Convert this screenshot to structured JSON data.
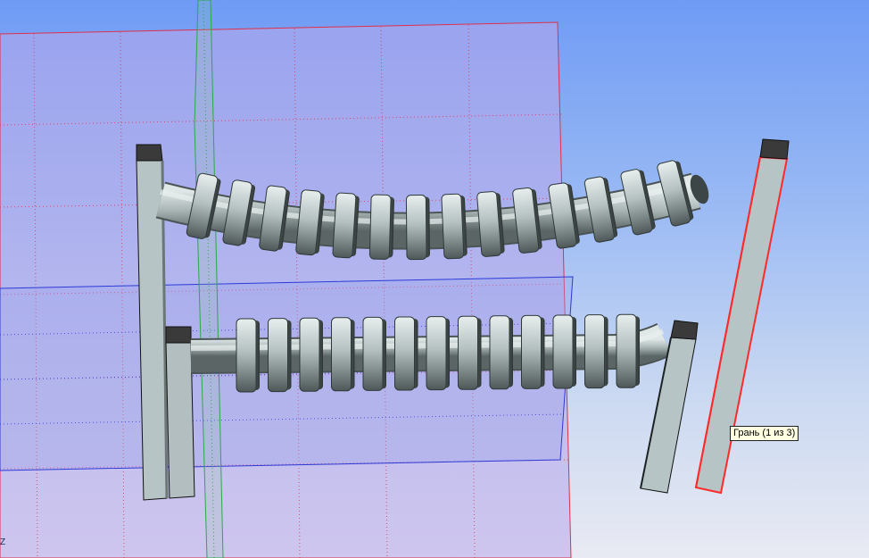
{
  "viewport": {
    "tooltip_text": "Грань (1 из 3)",
    "axis_label": "Z",
    "colors": {
      "bg_top": "#6f9bf5",
      "bg_bottom": "#e9eaf3",
      "plane_red_edge": "#e0304a",
      "plane_blue_edge": "#2d3ad8",
      "plane_green_edge": "#2ea84a",
      "solid_face": "#b7c4c6",
      "solid_top": "#3a3a3a",
      "highlight_edge": "#ff2a2a"
    }
  }
}
